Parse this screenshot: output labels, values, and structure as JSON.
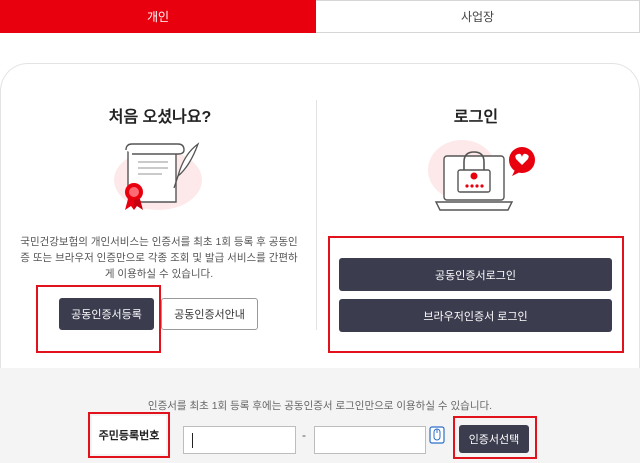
{
  "tabs": [
    {
      "label": "개인",
      "active": true
    },
    {
      "label": "사업장",
      "active": false
    }
  ],
  "left": {
    "title": "처음 오셨나요?",
    "description": "국민건강보험의 개인서비스는 인증서를 최초 1회 등록 후 공동인증 또는 브라우저 인증만으로 각종 조회 및 발급 서비스를 간편하게 이용하실 수 있습니다.",
    "register_button": "공동인증서등록",
    "guide_button": "공동인증서안내",
    "illustration": "certificate-scroll-icon"
  },
  "right": {
    "title": "로그인",
    "joint_login_button": "공동인증서로그인",
    "browser_login_button": "브라우저인증서 로그인",
    "illustration": "laptop-lock-icon"
  },
  "bottom": {
    "notice": "인증서를 최초 1회 등록 후에는 공동인증서 로그인만으로 이용하실 수 있습니다.",
    "rrn_label": "주민등록번호",
    "rrn_first": "",
    "rrn_second": "",
    "rrn_separator": "-",
    "select_button": "인증서선택"
  },
  "colors": {
    "accent_red": "#e8000f",
    "dark_button": "#3b3d4f",
    "highlight_box": "#e1121b"
  }
}
